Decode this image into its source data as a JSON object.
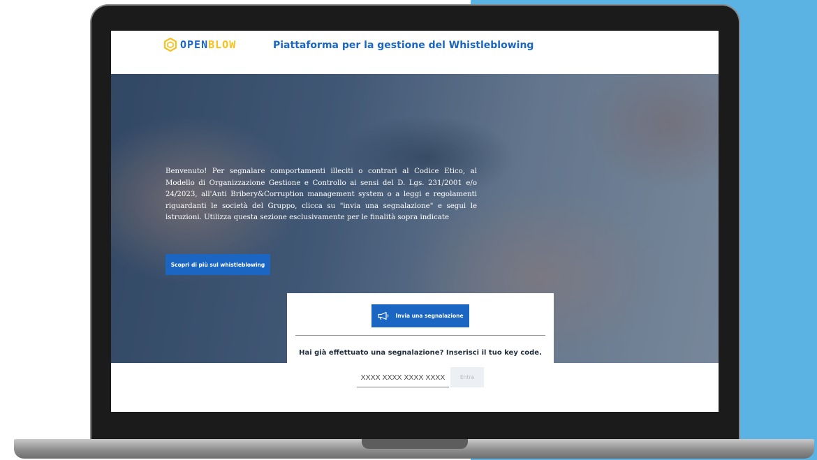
{
  "header": {
    "logo_text_left": "OPEN",
    "logo_text_right": "BLOW",
    "platform_title": "Piattaforma per la gestione del Whistleblowing"
  },
  "hero": {
    "welcome_text": "Benvenuto! Per segnalare comportamenti illeciti o contrari al Codice Etico, al Modello di Organizzazione Gestione e Controllo ai sensi del D. Lgs. 231/2001 e/o 24/2023, all'Anti Bribery&Corruption management system o a leggi e regolamenti riguardanti le società del Gruppo, clicca su \"invia una segnalazione\" e segui le istruzioni. Utilizza questa sezione esclusivamente per le finalità sopra indicate",
    "discover_button_label": "Scopri di più sul whistleblowing"
  },
  "report_card": {
    "send_button_label": "Invia una segnalazione",
    "send_icon": "megaphone-icon",
    "key_code_label": "Hai già effettuato una segnalazione? Inserisci il tuo key code.",
    "key_code_placeholder": "XXXX XXXX XXXX XXXX",
    "enter_button_label": "Entra"
  },
  "colors": {
    "brand_blue": "#1a66c2",
    "brand_yellow": "#f5c21b",
    "background_panel": "#5ab3e2",
    "laptop_frame": "#1b1b1b"
  },
  "icons": {
    "logo": "hexagon-cube-logo-icon",
    "send": "megaphone-icon"
  }
}
